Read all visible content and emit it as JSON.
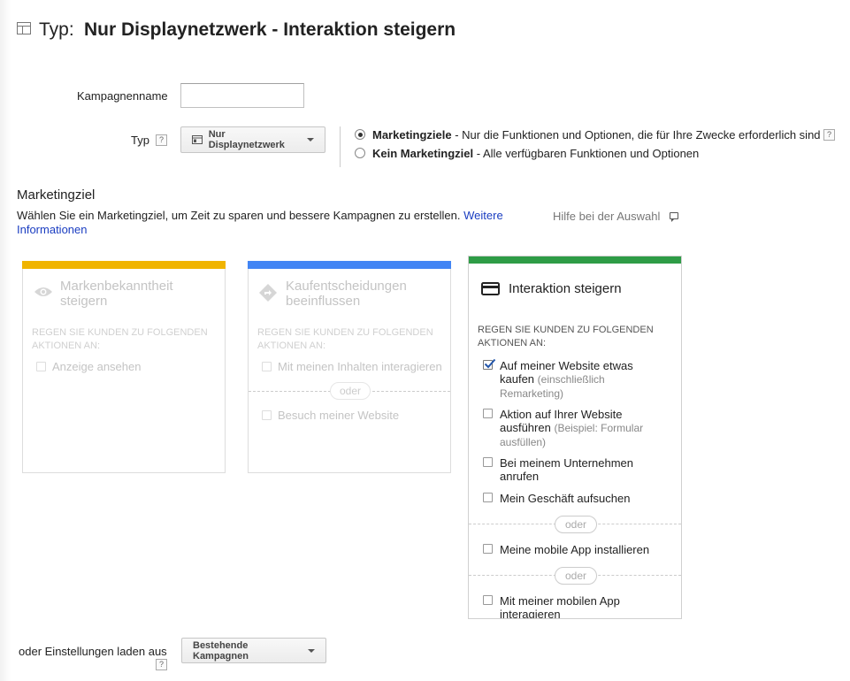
{
  "header": {
    "prefix": "Typ:",
    "title": "Nur Displaynetzwerk - Interaktion steigern",
    "icon": "layout-icon"
  },
  "form": {
    "campaign_name_label": "Kampagnenname",
    "campaign_name_value": "",
    "type_label": "Typ",
    "help_glyph": "?",
    "type_button": "Nur Displaynetzwerk",
    "radio_options": [
      {
        "bold": "Marketingziele",
        "text": " - Nur die Funktionen und Optionen, die für Ihre Zwecke erforderlich sind",
        "selected": true
      },
      {
        "bold": "Kein Marketingziel",
        "text": " - Alle verfügbaren Funktionen und Optionen",
        "selected": false
      }
    ]
  },
  "goals": {
    "section_title": "Marketingziel",
    "description": "Wählen Sie ein Marketingziel, um Zeit zu sparen und bessere Kampagnen zu erstellen.",
    "link_text": "Weitere Informationen",
    "help_link": "Hilfe bei der Auswahl",
    "cards": [
      {
        "title": "Markenbekanntheit steigern",
        "icon": "eye-icon",
        "color": "#f0b400",
        "subtitle": "REGEN SIE KUNDEN ZU FOLGENDEN AKTIONEN AN:",
        "options": [
          {
            "label": "Anzeige ansehen",
            "checked": false
          }
        ]
      },
      {
        "title": "Kaufentscheidungen beeinflussen",
        "icon": "directions-icon",
        "color": "#4285f4",
        "subtitle": "REGEN SIE KUNDEN ZU FOLGENDEN AKTIONEN AN:",
        "options": [
          {
            "label": "Mit meinen Inhalten interagieren",
            "checked": false
          },
          {
            "label": "Besuch meiner Website",
            "checked": false
          }
        ],
        "separator": "oder"
      },
      {
        "title": "Interaktion steigern",
        "icon": "credit-card-icon",
        "color": "#2e9c46",
        "subtitle": "REGEN SIE KUNDEN ZU FOLGENDEN AKTIONEN AN:",
        "options": [
          {
            "label": "Auf meiner Website etwas kaufen",
            "note": "(einschließlich Remarketing)",
            "checked": true
          },
          {
            "label": "Aktion auf Ihrer Website ausführen",
            "note": "(Beispiel: Formular ausfüllen)",
            "checked": false
          },
          {
            "label": "Bei meinem Unternehmen anrufen",
            "checked": false
          },
          {
            "label": "Mein Geschäft aufsuchen",
            "checked": false
          },
          {
            "label": "Meine mobile App installieren",
            "checked": false
          },
          {
            "label": "Mit meiner mobilen App interagieren",
            "checked": false
          }
        ],
        "separator": "oder"
      }
    ]
  },
  "footer": {
    "load_label": "oder Einstellungen laden aus",
    "load_button": "Bestehende Kampagnen"
  }
}
